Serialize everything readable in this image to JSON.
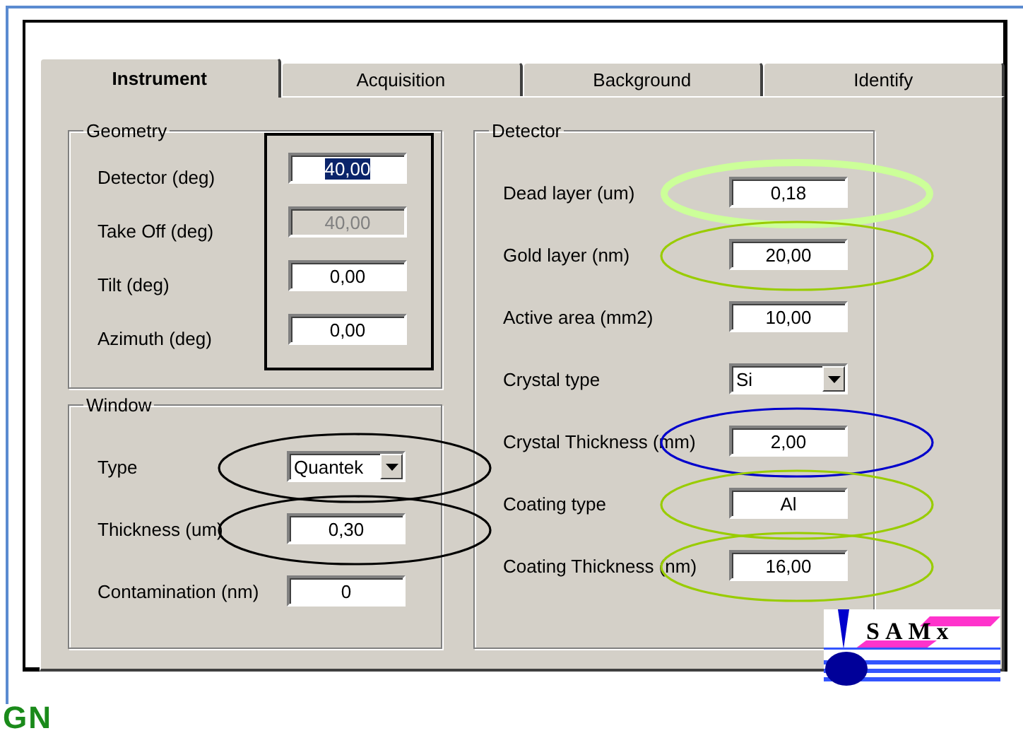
{
  "tabs": [
    {
      "label": "Instrument",
      "selected": true
    },
    {
      "label": "Acquisition",
      "selected": false
    },
    {
      "label": "Background",
      "selected": false
    },
    {
      "label": "Identify",
      "selected": false
    }
  ],
  "columns": [
    {
      "groups": [
        {
          "title": "Geometry",
          "outlined": true,
          "rows": [
            {
              "label": "Detector (deg)",
              "kind": "text",
              "value": "40,00",
              "selected_text": true,
              "disabled": false
            },
            {
              "label": "Take Off (deg)",
              "kind": "text",
              "value": "40,00",
              "selected_text": false,
              "disabled": true
            },
            {
              "label": "Tilt (deg)",
              "kind": "text",
              "value": "0,00",
              "selected_text": false,
              "disabled": false
            },
            {
              "label": "Azimuth (deg)",
              "kind": "text",
              "value": "0,00",
              "selected_text": false,
              "disabled": false
            }
          ]
        },
        {
          "title": "Window",
          "outlined": false,
          "rows": [
            {
              "label": "Type",
              "kind": "combo",
              "value": "Quantek",
              "annotation": {
                "color": "#000000",
                "heavy": false
              }
            },
            {
              "label": "Thickness (um)",
              "kind": "text",
              "value": "0,30",
              "selected_text": false,
              "disabled": false,
              "annotation": {
                "color": "#000000",
                "heavy": false
              }
            },
            {
              "label": "Contamination (nm)",
              "kind": "text",
              "value": "0",
              "selected_text": false,
              "disabled": false
            }
          ]
        }
      ]
    },
    {
      "groups": [
        {
          "title": "Detector",
          "outlined": false,
          "rows": [
            {
              "label": "Dead layer (um)",
              "kind": "text",
              "value": "0,18",
              "selected_text": false,
              "disabled": false,
              "annotation": {
                "color": "#ccff99",
                "heavy": true
              }
            },
            {
              "label": "Gold layer (nm)",
              "kind": "text",
              "value": "20,00",
              "selected_text": false,
              "disabled": false,
              "annotation": {
                "color": "#99cc00",
                "heavy": false
              }
            },
            {
              "label": "Active area (mm2)",
              "kind": "text",
              "value": "10,00",
              "selected_text": false,
              "disabled": false
            },
            {
              "label": "Crystal type",
              "kind": "combo",
              "value": "Si"
            },
            {
              "label": "Crystal Thickness (mm)",
              "kind": "text",
              "value": "2,00",
              "selected_text": false,
              "disabled": false,
              "annotation": {
                "color": "#0000cc",
                "heavy": false
              }
            },
            {
              "label": "Coating type",
              "kind": "text",
              "value": "Al",
              "selected_text": false,
              "disabled": false,
              "annotation": {
                "color": "#99cc00",
                "heavy": false
              }
            },
            {
              "label": "Coating Thickness (nm)",
              "kind": "text",
              "value": "16,00",
              "selected_text": false,
              "disabled": false,
              "annotation": {
                "color": "#99cc00",
                "heavy": false
              }
            }
          ]
        }
      ]
    }
  ],
  "logo": {
    "text": "SAMx"
  },
  "footer_logo": {
    "text": "GN"
  }
}
